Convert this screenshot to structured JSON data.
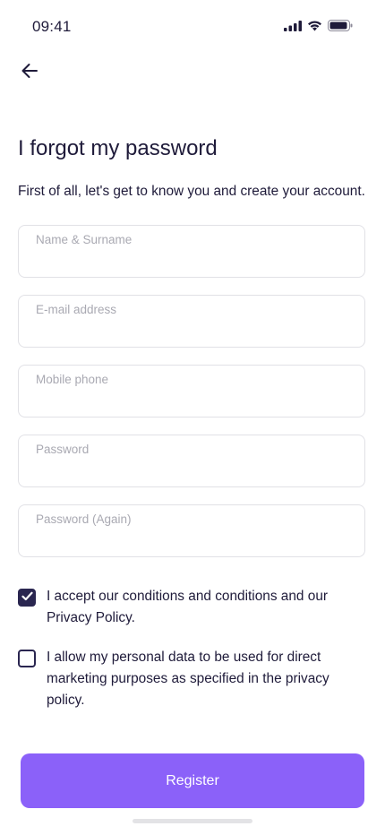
{
  "status_bar": {
    "time": "09:41",
    "icons": [
      "signal-icon",
      "wifi-icon",
      "battery-icon"
    ]
  },
  "header": {
    "back_icon": "arrow-left-icon",
    "title": "I forgot my password",
    "subtitle": "First of all, let's get to know you and create your account."
  },
  "form": {
    "fields": [
      {
        "label": "Name & Surname",
        "value": ""
      },
      {
        "label": "E-mail address",
        "value": ""
      },
      {
        "label": "Mobile phone",
        "value": ""
      },
      {
        "label": "Password",
        "value": ""
      },
      {
        "label": "Password (Again)",
        "value": ""
      }
    ],
    "consents": [
      {
        "label": "I accept our conditions and conditions and our Privacy Policy.",
        "checked": true
      },
      {
        "label": "I allow my personal data to be used for direct marketing purposes as specified in the privacy policy.",
        "checked": false
      }
    ],
    "submit_label": "Register"
  },
  "colors": {
    "primary": "#8b61f9",
    "text": "#1f1b3a",
    "placeholder": "#a9a9b2",
    "border": "#e1e1e6",
    "checkbox": "#2a2650"
  }
}
